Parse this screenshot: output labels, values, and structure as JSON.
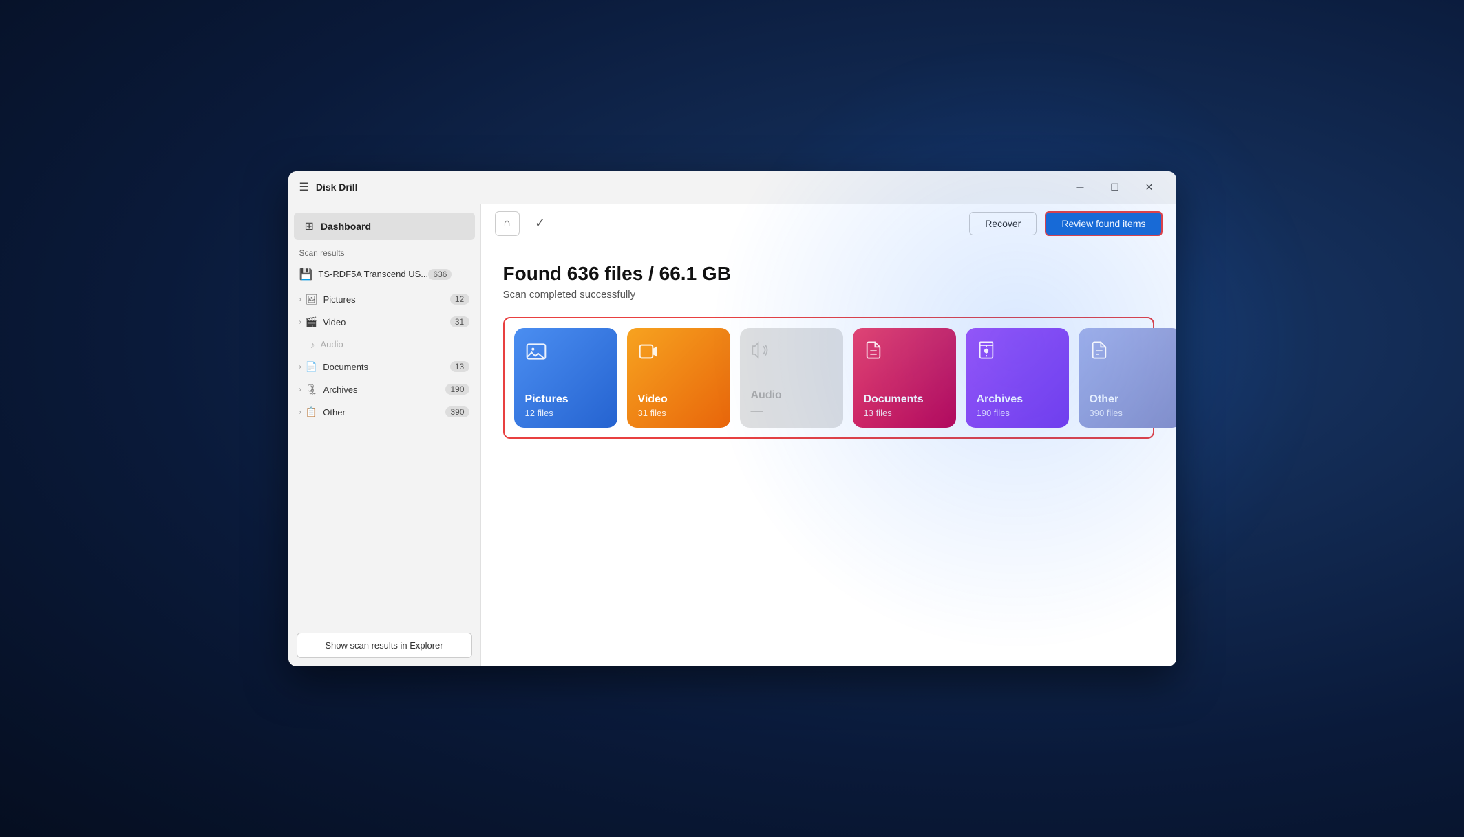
{
  "app": {
    "title": "Disk Drill"
  },
  "titlebar": {
    "menu_label": "☰",
    "minimize_label": "─",
    "maximize_label": "☐",
    "close_label": "✕"
  },
  "sidebar": {
    "dashboard_label": "Dashboard",
    "scan_results_label": "Scan results",
    "drive_name": "TS-RDF5A Transcend US...",
    "drive_count": "636",
    "categories": [
      {
        "icon": "🖼",
        "name": "Pictures",
        "count": "12"
      },
      {
        "icon": "🎬",
        "name": "Video",
        "count": "31"
      },
      {
        "icon": "♪",
        "name": "Audio",
        "count": ""
      },
      {
        "icon": "📄",
        "name": "Documents",
        "count": "13"
      },
      {
        "icon": "🗜",
        "name": "Archives",
        "count": "190"
      },
      {
        "icon": "📋",
        "name": "Other",
        "count": "390"
      }
    ],
    "show_in_explorer_label": "Show scan results in Explorer"
  },
  "toolbar": {
    "recover_label": "Recover",
    "review_label": "Review found items"
  },
  "main": {
    "found_title": "Found 636 files / 66.1 GB",
    "scan_status": "Scan completed successfully",
    "categories": [
      {
        "name": "Pictures",
        "count": "12 files",
        "icon": "🖼",
        "style": "pictures"
      },
      {
        "name": "Video",
        "count": "31 files",
        "icon": "🎥",
        "style": "video"
      },
      {
        "name": "Audio",
        "count": "—",
        "icon": "♪",
        "style": "audio"
      },
      {
        "name": "Documents",
        "count": "13 files",
        "icon": "📄",
        "style": "documents"
      },
      {
        "name": "Archives",
        "count": "190 files",
        "icon": "🗜",
        "style": "archives"
      },
      {
        "name": "Other",
        "count": "390 files",
        "icon": "📋",
        "style": "other"
      }
    ]
  }
}
